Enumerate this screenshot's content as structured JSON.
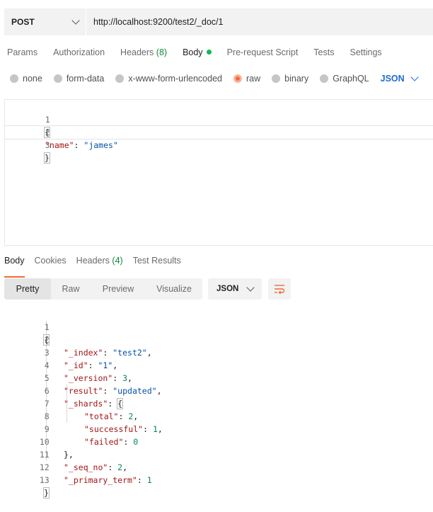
{
  "request": {
    "method": "POST",
    "url": "http://localhost:9200/test2/_doc/1",
    "tabs": [
      {
        "label": "Params"
      },
      {
        "label": "Authorization"
      },
      {
        "label": "Headers",
        "count": "(8)"
      },
      {
        "label": "Body"
      },
      {
        "label": "Pre-request Script"
      },
      {
        "label": "Tests"
      },
      {
        "label": "Settings"
      }
    ],
    "active_tab": "Body",
    "body_types": [
      "none",
      "form-data",
      "x-www-form-urlencoded",
      "raw",
      "binary",
      "GraphQL"
    ],
    "selected_body_type": "raw",
    "format": "JSON",
    "body_lines": [
      {
        "num": "1",
        "text": "{"
      },
      {
        "num": "2",
        "key": "\"name\"",
        "value": "\"james\""
      },
      {
        "num": "3",
        "text": "}"
      }
    ]
  },
  "response": {
    "tabs": [
      {
        "label": "Body"
      },
      {
        "label": "Cookies"
      },
      {
        "label": "Headers",
        "count": "(4)"
      },
      {
        "label": "Test Results"
      }
    ],
    "active_tab": "Body",
    "views": [
      "Pretty",
      "Raw",
      "Preview",
      "Visualize"
    ],
    "active_view": "Pretty",
    "format": "JSON",
    "lines": [
      {
        "num": "1",
        "text": "{"
      },
      {
        "num": "2",
        "key": "\"_index\"",
        "value": "\"test2\"",
        "suffix": ","
      },
      {
        "num": "3",
        "key": "\"_id\"",
        "value": "\"1\"",
        "suffix": ","
      },
      {
        "num": "4",
        "key": "\"_version\"",
        "value": "3",
        "suffix": ","
      },
      {
        "num": "5",
        "key": "\"result\"",
        "value": "\"updated\"",
        "suffix": ","
      },
      {
        "num": "6",
        "key": "\"_shards\"",
        "value": "{"
      },
      {
        "num": "7",
        "key": "\"total\"",
        "value": "2",
        "suffix": ","
      },
      {
        "num": "8",
        "key": "\"successful\"",
        "value": "1",
        "suffix": ","
      },
      {
        "num": "9",
        "key": "\"failed\"",
        "value": "0"
      },
      {
        "num": "10",
        "text": "},"
      },
      {
        "num": "11",
        "key": "\"_seq_no\"",
        "value": "2",
        "suffix": ","
      },
      {
        "num": "12",
        "key": "\"_primary_term\"",
        "value": "1"
      },
      {
        "num": "13",
        "text": "}"
      }
    ]
  },
  "colors": {
    "accent": "#f26b3a",
    "link": "#1c6bd6",
    "success": "#0cbb52"
  }
}
